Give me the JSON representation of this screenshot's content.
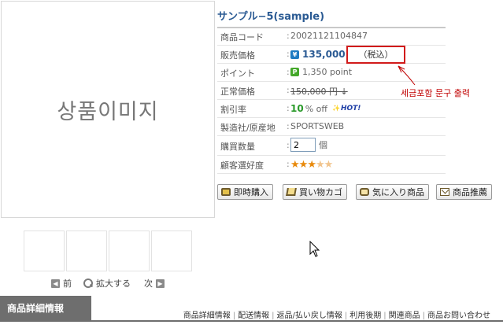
{
  "image": {
    "placeholder": "상품이미지"
  },
  "thumbnails": {
    "count": 4
  },
  "thumb_nav": {
    "prev": "前",
    "zoom": "拡大する",
    "next": "次"
  },
  "product": {
    "title": "サンプル−5(sample)"
  },
  "info": {
    "code": {
      "label": "商品コード",
      "value": "20021121104847"
    },
    "price": {
      "label": "販売価格",
      "icon": "yen-icon",
      "value": "135,000"
    },
    "tax_note": "（税込）",
    "point": {
      "label": "ポイント",
      "icon": "point-icon",
      "value": "1,350 point"
    },
    "regular": {
      "label": "正常価格",
      "value": "150,000 円 ↓"
    },
    "discount": {
      "label": "割引率",
      "value": "10",
      "unit": "% off",
      "badge": "HOT!"
    },
    "maker": {
      "label": "製造社/原産地",
      "value": "SPORTSWEB"
    },
    "quantity": {
      "label": "購買数量",
      "value": "2",
      "unit": "個"
    },
    "rating": {
      "label": "顧客選好度",
      "stars_filled": 3,
      "stars_total": 5
    }
  },
  "annotation": {
    "text": "세금포함 문구 출력",
    "color": "#c00000"
  },
  "buttons": {
    "buy_now": "即時購入",
    "cart": "買い物カゴ",
    "favorite": "気に入り商品",
    "recommend": "商品推薦"
  },
  "bottom_tabs": {
    "active": "商品詳細情報",
    "links": [
      "商品詳細情報",
      "配送情報",
      "返品/払い戻し情報",
      "利用後期",
      "関連商品",
      "商品お問い合わせ"
    ]
  },
  "colors": {
    "accent": "#2a5a93",
    "highlight_box": "#d11a1a",
    "tab_bg": "#6e6e6e"
  }
}
